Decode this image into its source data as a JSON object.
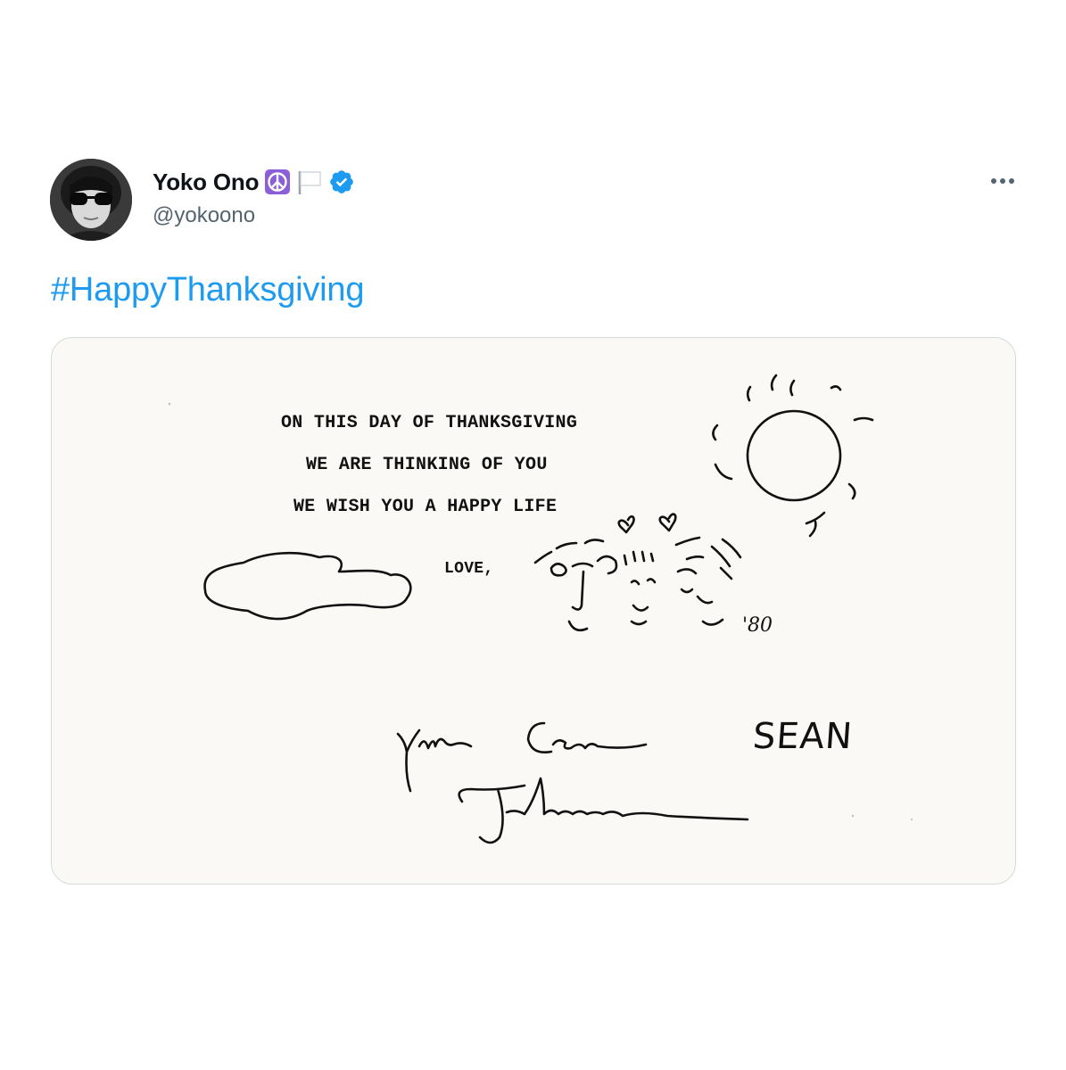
{
  "tweet": {
    "display_name": "Yoko Ono",
    "handle": "@yokoono",
    "name_emojis": [
      "peace-symbol-icon",
      "white-flag-icon"
    ],
    "verified": true,
    "hashtag": "#HappyThanksgiving"
  },
  "media": {
    "typed_lines": [
      "ON THIS DAY OF THANKSGIVING",
      "WE ARE THINKING OF YOU",
      "WE WISH YOU A HAPPY LIFE",
      "LOVE,"
    ],
    "year": "'80",
    "handwritten_name": "SEAN",
    "signatures": [
      "Yoko Ono",
      "John Lennon"
    ]
  },
  "colors": {
    "link": "#1d9bf0",
    "text": "#0f1419",
    "muted": "#536471",
    "verified": "#1d9bf0",
    "peace": "#7a4ec7",
    "card_bg": "#faf9f5"
  }
}
